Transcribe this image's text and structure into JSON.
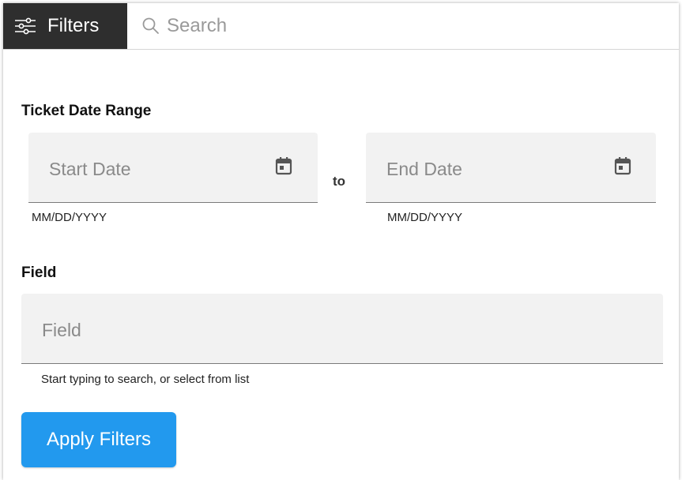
{
  "toolbar": {
    "filters_label": "Filters",
    "filters_icon": "sliders-icon",
    "search_icon": "search-icon",
    "search_placeholder": "Search"
  },
  "date_range": {
    "title": "Ticket Date Range",
    "start_placeholder": "Start Date",
    "start_hint": "MM/DD/YYYY",
    "separator": "to",
    "end_placeholder": "End Date",
    "end_hint": "MM/DD/YYYY",
    "calendar_icon": "calendar-icon"
  },
  "field": {
    "title": "Field",
    "placeholder": "Field",
    "hint": "Start typing to search, or select from list"
  },
  "apply_button": {
    "label": "Apply Filters",
    "color": "#2299ee"
  },
  "colors": {
    "toolbar_dark": "#2e2e2e",
    "input_background": "#f2f2f2"
  }
}
